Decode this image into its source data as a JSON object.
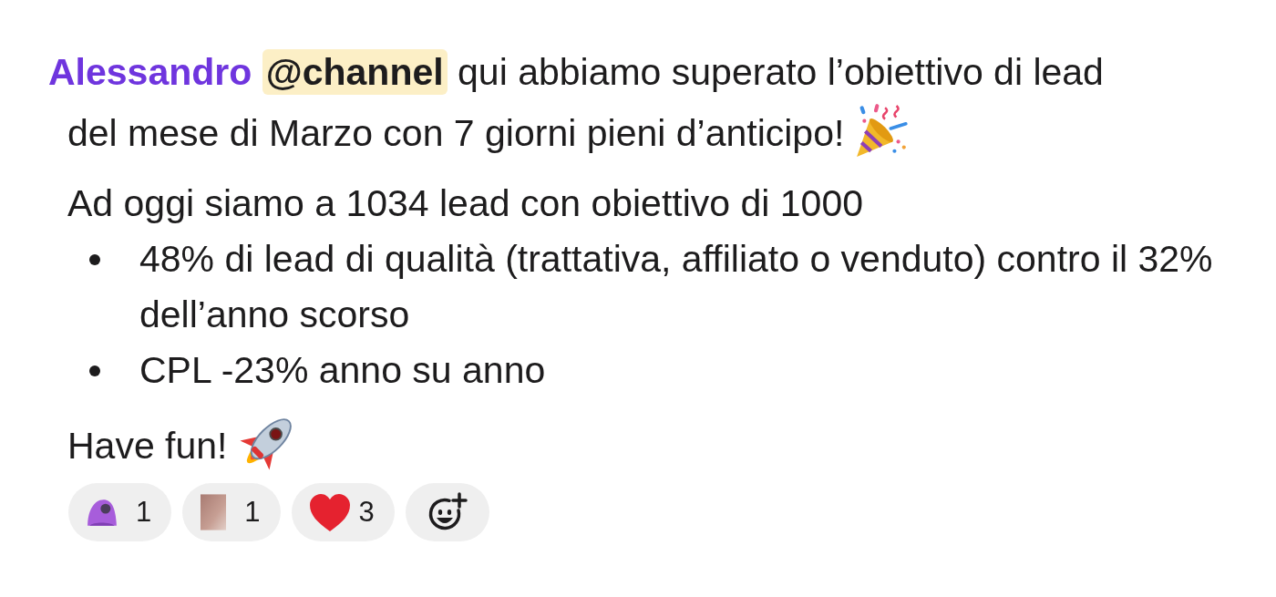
{
  "message": {
    "author": "Alessandro",
    "mention": "@channel",
    "blocks": [
      {
        "kind": "paragraph",
        "text": "qui abbiamo superato l’obiettivo di lead del mese di Marzo con 7 giorni pieni d’anticipo!"
      },
      {
        "kind": "paragraph",
        "text": "Ad oggi siamo a 1034 lead con obiettivo di 1000"
      },
      {
        "kind": "bullets",
        "items": [
          "48% di lead di qualità (trattativa, affiliato o venduto) contro il 32% dell’anno scorso",
          "CPL -23% anno su anno"
        ]
      },
      {
        "kind": "paragraph",
        "text": "Have fun!"
      }
    ]
  },
  "reactions": [
    {
      "count": "1"
    },
    {
      "count": "1"
    },
    {
      "count": "3"
    }
  ]
}
